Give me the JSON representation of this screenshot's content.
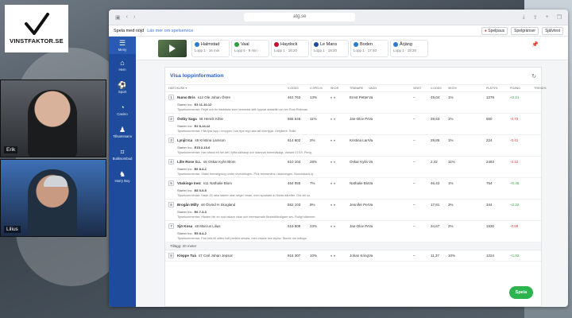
{
  "logo": {
    "text": "VINSTFAKTOR.SE"
  },
  "cams": [
    {
      "name": "Erik"
    },
    {
      "name": "Lilius"
    }
  ],
  "browser": {
    "url": "atg.se"
  },
  "promo": {
    "text": "Spela med nöjd",
    "link": "Läs mer om spelservice",
    "buttons": [
      "Spelpaus",
      "Spelgränser",
      "Självtest"
    ]
  },
  "sidebar": [
    {
      "icon": "menu-icon",
      "glyph": "☰",
      "label": "Meny"
    },
    {
      "icon": "home-icon",
      "glyph": "⌂",
      "label": "Hem"
    },
    {
      "icon": "sport-icon",
      "glyph": "⚽",
      "label": "Sport"
    },
    {
      "icon": "casino-icon",
      "glyph": "◔",
      "label": "Casino"
    },
    {
      "icon": "tillsammans-icon",
      "glyph": "♟",
      "label": "Tillsammans"
    },
    {
      "icon": "butik-icon",
      "glyph": "⌗",
      "label": "Butiksombud"
    },
    {
      "icon": "harry-boy-icon",
      "glyph": "♞",
      "label": "Harry Boy"
    }
  ],
  "races": [
    {
      "name": "Halmstad",
      "sub": "Lopp 1 · 16 min",
      "color": "#2e7ad1"
    },
    {
      "name": "Vaal",
      "sub": "Lopp 5 · 9 min",
      "color": "#2e9e45"
    },
    {
      "name": "Haydock",
      "sub": "Lopp 1 · 16:20",
      "color": "#c8102e"
    },
    {
      "name": "Le Mans",
      "sub": "Lopp 1 · 16:20",
      "color": "#1e4b9c"
    },
    {
      "name": "Boden",
      "sub": "Lopp 1 · 17:40",
      "color": "#2e7ad1"
    },
    {
      "name": "Årjäng",
      "sub": "Lopp 1 · 18:20",
      "color": "#2e7ad1"
    }
  ],
  "card": {
    "title": "Visa loppinformation"
  },
  "columns": [
    "HÄST/KUSK ▾",
    "V-ODDS",
    "V-SPEL%",
    "SKOR",
    "TRÄNARE",
    "VAGN",
    "VINST",
    "V-ODDS",
    "SEG%",
    "PLATS%",
    "POÄNG",
    "TREND%"
  ],
  "horses": [
    {
      "num": "1",
      "name": "Numo Bris",
      "meta": "s12",
      "driver": "Ole Johan Östre",
      "odds": "461 763",
      "pct": "13%",
      "shoe": "◐ ◐",
      "trainer": "Ernst Petter Knutsen",
      "cart": "Va",
      "win": "–",
      "v": "49,04",
      "seg": "1%",
      "plats": "1278",
      "trend": "+2.21",
      "trend_class": "pos",
      "start": "Starter Inc.",
      "record": "E3  11-10-12",
      "tip": "Tipsekommentar: Rejäl och fin tidsbästa som nemmast sett öppnar statsfält och tvn Runt Rekmas."
    },
    {
      "num": "2",
      "name": "Östby Saga",
      "meta": "s8",
      "driver": "Henrik Kihle",
      "odds": "555 646",
      "pct": "11%",
      "shoe": "◐ ◐",
      "trainer": "Jan-Olov Persson",
      "cart": "Va",
      "win": "–",
      "v": "28,53",
      "seg": "1%",
      "plats": "650",
      "trend": "-0.73",
      "trend_class": "neg",
      "start": "Starter Inc.",
      "record": "E2  8-14-12",
      "tip": "Tipsekommentar: Fått fyra lopp i kroppen i sin nya regi utan att övertyga. Oerjämnt. Svårt."
    },
    {
      "num": "3",
      "name": "Lynjit Ica",
      "meta": "s9",
      "driver": "Kristina Larsson",
      "odds": "614 602",
      "pct": "2%",
      "shoe": "◐ ◐",
      "trainer": "Kristina Larsson",
      "cart": "Va",
      "win": "–",
      "v": "29,85",
      "seg": "1%",
      "plats": "224",
      "trend": "-0.41",
      "trend_class": "neg",
      "start": "Starter Inc.",
      "record": "E15  2-10-6",
      "tip": "Tipsekommentar: Har bästal en hel del i tyffa sällskap och stamnat formmässigt. Variant 07/19. Peng."
    },
    {
      "num": "4",
      "name": "Lille Rose G.L",
      "meta": "s6",
      "driver": "Oskar Kylin Blom",
      "odds": "610 104",
      "pct": "28%",
      "shoe": "◐ ◐",
      "trainer": "Oskar Kylin Blom",
      "cart": "Va",
      "win": "–",
      "v": "2,42",
      "seg": "11%",
      "plats": "2483",
      "trend": "-3.12",
      "trend_class": "neg",
      "start": "Starter Inc.",
      "record": "E6  8-4-2",
      "tip": "Tipsekommentar: Stabil formstigning under utvecklingen. Pick bredsmäns i stabningen. Nonchalans ej."
    },
    {
      "num": "5",
      "name": "Väskinge Inez",
      "meta": "s11",
      "driver": "Nathalie Blom",
      "odds": "464 055",
      "pct": "7%",
      "shoe": "◐ ◐",
      "trainer": "Nathalie Blom",
      "cart": "Va",
      "win": "–",
      "v": "46,43",
      "seg": "1%",
      "plats": "754",
      "trend": "+0.45",
      "trend_class": "pos",
      "start": "Starter Inc.",
      "record": "E8  5-9-5",
      "tip": "Tipsekommentar: Hade 25 raka starter utan seger innan, men spurtade in första därefter. Gör ett nu."
    },
    {
      "num": "6",
      "name": "Brogån Milly",
      "meta": "s8",
      "driver": "Öivind H Skogland",
      "odds": "552 103",
      "pct": "9%",
      "shoe": "◐ ◐",
      "trainer": "Jennifer Persson",
      "cart": "Va",
      "win": "–",
      "v": "17,81",
      "seg": "3%",
      "plats": "344",
      "trend": "+2.22",
      "trend_class": "pos",
      "start": "Starter Inc.",
      "record": "E6  7-3-3",
      "tip": "Tipsekommentar: Hästen blir en nod rakare visar och intresserade försteklfärdigare sev. Roligt stämmer."
    },
    {
      "num": "7",
      "name": "Sjö Kosa",
      "meta": "s8",
      "driver": "Marcus Lilius",
      "odds": "519 806",
      "pct": "23%",
      "shoe": "◐ ◐",
      "trainer": "Jan-Olov Persson",
      "cart": "Va",
      "win": "–",
      "v": "34,67",
      "seg": "2%",
      "plats": "1930",
      "trend": "-0.59",
      "trend_class": "neg",
      "start": "Starter Inc.",
      "record": "E5  8-4-2",
      "tip": "Tipsekommentar: Fick leta till sitten helt perfekt senast, men visade bra styrka. Storek om många."
    }
  ],
  "section_label": "Tillägg: 20 meter",
  "extra_horse": {
    "num": "8",
    "name": "Kleppe Tuà",
    "meta": "s7",
    "driver": "Carl Johan Jepson",
    "odds": "916 307",
    "pct": "10%",
    "shoe": "◐ ◐",
    "trainer": "Johan Kringeland Eriksen",
    "cart": "Va",
    "win": "–",
    "v": "11,37",
    "seg": "10%",
    "plats": "1224",
    "trend": "+1.02",
    "trend_class": "pos"
  },
  "fab": {
    "label": "Spela"
  }
}
